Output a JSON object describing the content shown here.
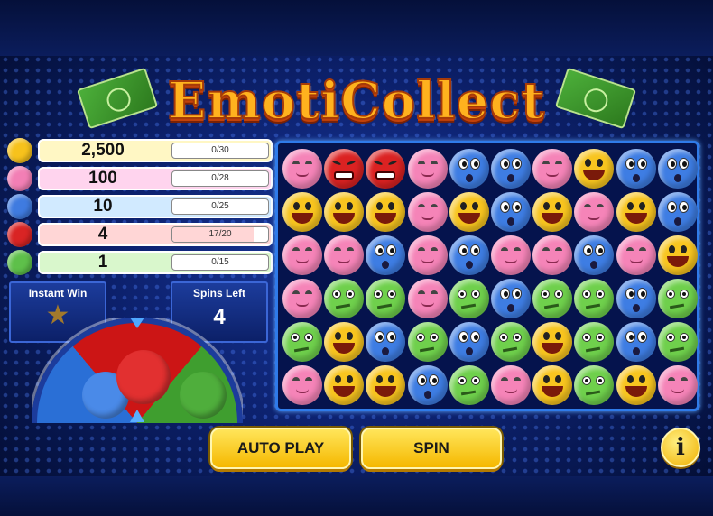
{
  "title": "EmotiCollect",
  "paytable": [
    {
      "prize": "2,500",
      "progress": "0/30",
      "fraction": 0.0,
      "emoji": "yellow-smiley",
      "color": "#f7c21c",
      "bar": "#fff7c4"
    },
    {
      "prize": "100",
      "progress": "0/28",
      "fraction": 0.0,
      "emoji": "pink-smiley",
      "color": "#f27fb5",
      "bar": "#ffd4ee"
    },
    {
      "prize": "10",
      "progress": "0/25",
      "fraction": 0.0,
      "emoji": "blue-surprised",
      "color": "#3f7be0",
      "bar": "#d1eaff"
    },
    {
      "prize": "4",
      "progress": "17/20",
      "fraction": 0.85,
      "emoji": "red-angry",
      "color": "#d92424",
      "bar": "#ffd6d6"
    },
    {
      "prize": "1",
      "progress": "0/15",
      "fraction": 0.0,
      "emoji": "green-sick",
      "color": "#5ec04a",
      "bar": "#d9f7cc"
    }
  ],
  "instant_win": {
    "label": "Instant Win",
    "icon": "star-icon"
  },
  "spins_left": {
    "label": "Spins Left",
    "value": "4"
  },
  "buttons": {
    "auto_play": "AUTO PLAY",
    "spin": "SPIN",
    "info": "i"
  },
  "grid": [
    [
      "pink",
      "red",
      "red",
      "pink",
      "blue",
      "blue",
      "pink",
      "yellow",
      "blue",
      "blue"
    ],
    [
      "yellow",
      "yellow",
      "yellow",
      "pink",
      "yellow",
      "blue",
      "yellow",
      "pink",
      "yellow",
      "blue"
    ],
    [
      "pink",
      "pink",
      "blue",
      "pink",
      "blue",
      "pink",
      "pink",
      "blue",
      "pink",
      "yellow"
    ],
    [
      "pink",
      "green",
      "green",
      "pink",
      "green",
      "blue",
      "green",
      "green",
      "blue",
      "green"
    ],
    [
      "green",
      "yellow",
      "blue",
      "green",
      "blue",
      "green",
      "yellow",
      "green",
      "blue",
      "green"
    ],
    [
      "pink",
      "yellow",
      "yellow",
      "blue",
      "green",
      "pink",
      "yellow",
      "green",
      "yellow",
      "pink"
    ]
  ],
  "emoji_colors": {
    "yellow": "#f8c51f",
    "pink": "#f584b8",
    "blue": "#3e7de3",
    "red": "#db2222",
    "green": "#6fd04c"
  }
}
